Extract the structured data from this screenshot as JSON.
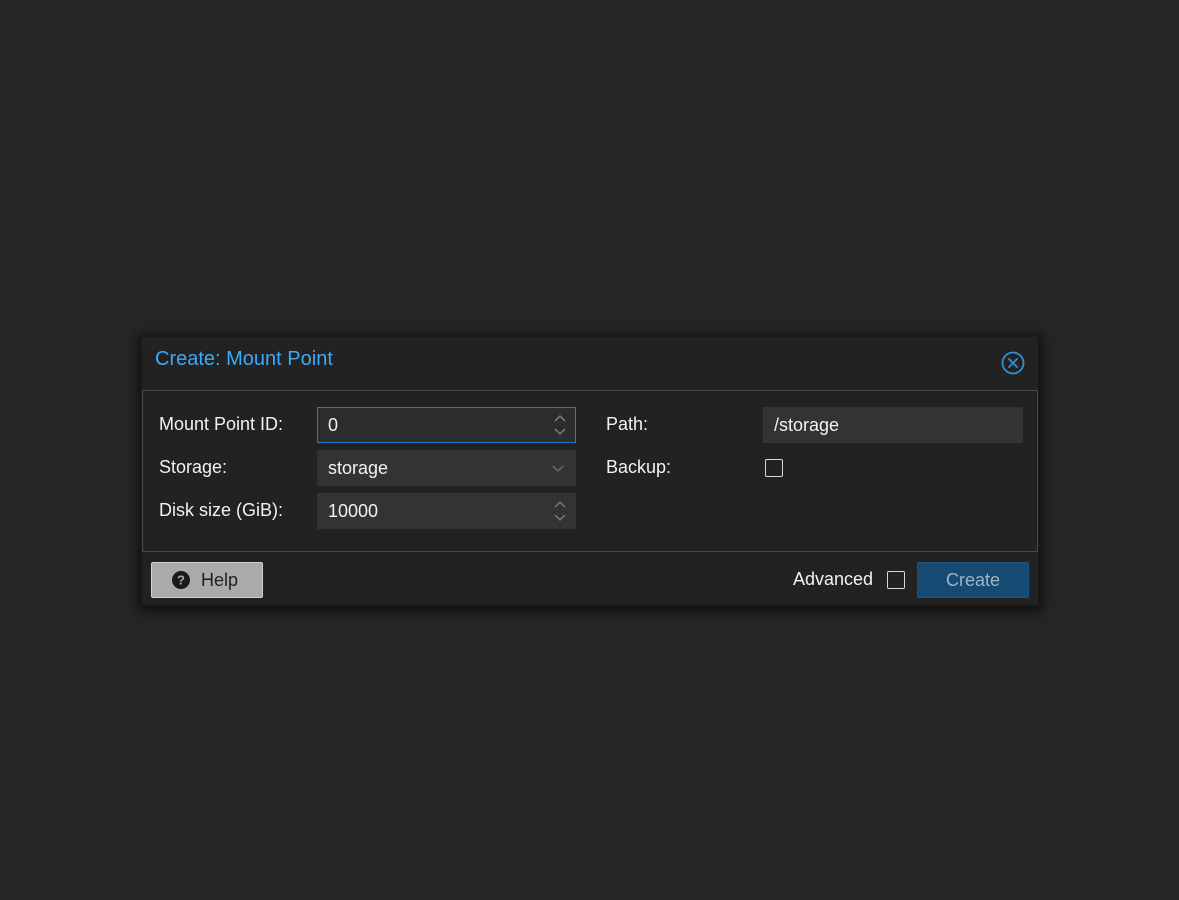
{
  "dialog": {
    "title": "Create: Mount Point",
    "close_icon": "close-circle-icon"
  },
  "form": {
    "mount_point_id": {
      "label": "Mount Point ID:",
      "value": "0"
    },
    "storage": {
      "label": "Storage:",
      "value": "storage"
    },
    "disk_size": {
      "label": "Disk size (GiB):",
      "value": "10000"
    },
    "path": {
      "label": "Path:",
      "value": "/storage"
    },
    "backup": {
      "label": "Backup:",
      "checked": false
    }
  },
  "footer": {
    "help_label": "Help",
    "help_icon": "question-circle-icon",
    "advanced_label": "Advanced",
    "advanced_checked": false,
    "create_label": "Create"
  },
  "colors": {
    "accent": "#3daaf5",
    "background": "#262626",
    "focus_border": "#1f7ad1",
    "primary_button": "#164a72"
  }
}
